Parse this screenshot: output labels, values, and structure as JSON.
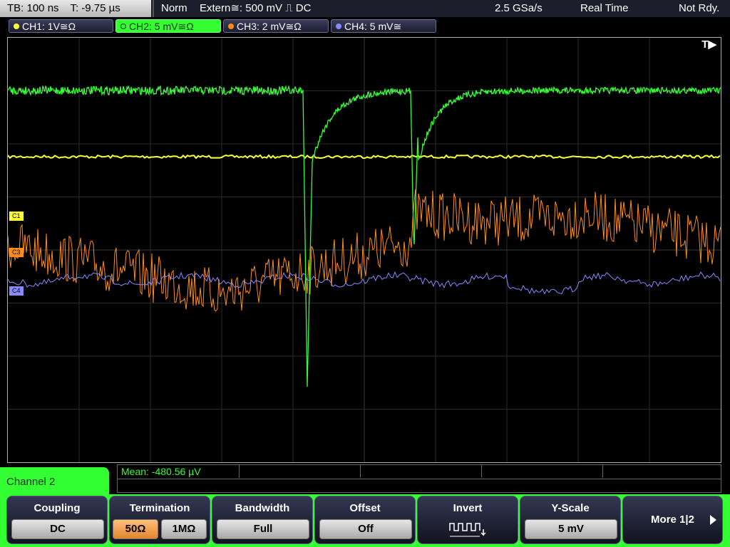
{
  "status": {
    "timebase": "TB: 100 ns",
    "trigger_time": "T: -9.75 µs",
    "mode": "Norm",
    "trigger_source": "Extern≅: 500 mV ⎍ DC",
    "sample_rate": "2.5 GSa/s",
    "acquisition": "Real Time",
    "state": "Not Rdy."
  },
  "channels": [
    {
      "label": "CH1: 1V≅Ω",
      "color": "#ffff33"
    },
    {
      "label": "CH2: 5 mV≅Ω",
      "color": "#33ff33"
    },
    {
      "label": "CH3: 2 mV≅Ω",
      "color": "#ff8c1a"
    },
    {
      "label": "CH4: 5 mV≅",
      "color": "#8888ff"
    }
  ],
  "plot": {
    "trigger_marker": "T▶",
    "channel_markers": [
      "C1",
      "C3",
      "C4"
    ]
  },
  "measurement": {
    "text": "Mean: -480.56 µV"
  },
  "channel_panel": {
    "title": "Channel 2"
  },
  "softkeys": {
    "coupling": {
      "label": "Coupling",
      "value": "DC"
    },
    "termination": {
      "label": "Termination",
      "option_50": "50Ω",
      "option_1m": "1MΩ"
    },
    "bandwidth": {
      "label": "Bandwidth",
      "value": "Full"
    },
    "offset": {
      "label": "Offset",
      "value": "Off"
    },
    "invert": {
      "label": "Invert"
    },
    "yscale": {
      "label": "Y-Scale",
      "value": "5 mV"
    },
    "more": {
      "label": "More 1|2"
    }
  }
}
